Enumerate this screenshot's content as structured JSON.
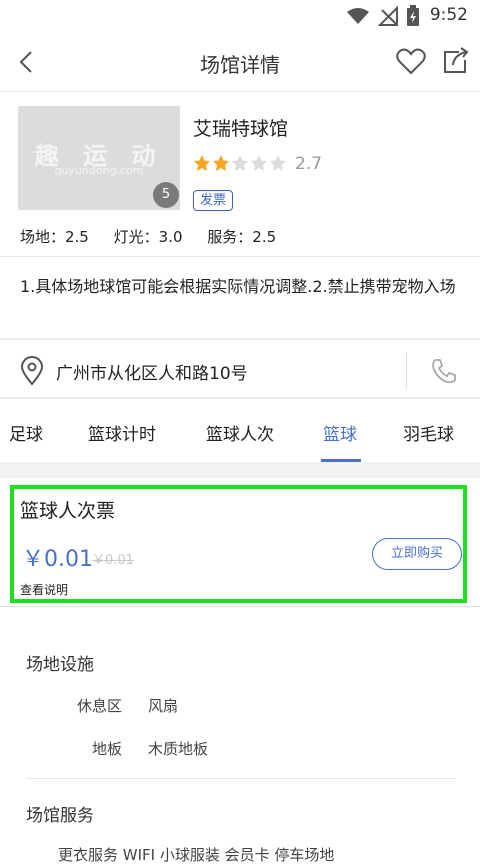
{
  "status_bar": {
    "time": "9:52"
  },
  "header": {
    "title": "场馆详情"
  },
  "venue": {
    "name": "艾瑞特球馆",
    "thumbnail_text": "趣 运 动",
    "thumbnail_subtext": "quyundong.com",
    "photo_count": "5",
    "rating": "2.7",
    "rating_stars": 2.7,
    "badge": "发票",
    "scores": {
      "field": "场地：2.5",
      "light": "灯光：3.0",
      "service": "服务：2.5"
    }
  },
  "notice": "1.具体场地球馆可能会根据实际情况调整.2.禁止携带宠物入场",
  "address": "广州市从化区人和路10号",
  "tabs": [
    "足球",
    "篮球计时",
    "篮球人次",
    "篮球",
    "羽毛球"
  ],
  "active_tab": "篮球",
  "ticket": {
    "name": "篮球人次票",
    "price": "￥0.01",
    "original_price": "￥0.01",
    "buy_label": "立即购买",
    "explain_label": "查看说明"
  },
  "facilities": {
    "title": "场地设施",
    "items": [
      {
        "label": "休息区",
        "value": "风扇"
      },
      {
        "label": "地板",
        "value": "木质地板"
      }
    ]
  },
  "services": {
    "title": "场馆服务",
    "partial_row": "更衣服务  WIFI  小球服装  会员卡  停车场地"
  },
  "colors": {
    "accent": "#4a6fd2",
    "star": "#f5a623",
    "highlight": "#1fe01f"
  }
}
